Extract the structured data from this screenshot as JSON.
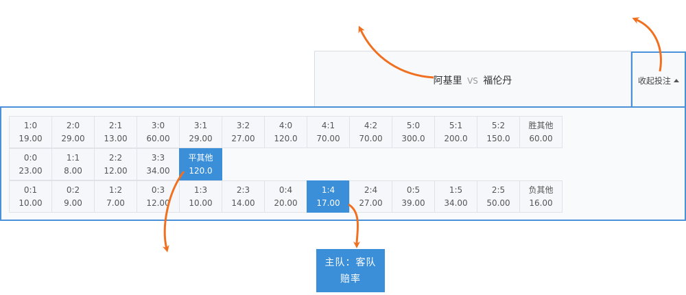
{
  "match": {
    "home": "阿基里",
    "vs": "VS",
    "away": "福伦丹"
  },
  "toggle": {
    "label": "收起投注"
  },
  "rows": [
    [
      {
        "score": "1:0",
        "odds": "19.00"
      },
      {
        "score": "2:0",
        "odds": "29.00"
      },
      {
        "score": "2:1",
        "odds": "13.00"
      },
      {
        "score": "3:0",
        "odds": "60.00"
      },
      {
        "score": "3:1",
        "odds": "29.00"
      },
      {
        "score": "3:2",
        "odds": "27.00"
      },
      {
        "score": "4:0",
        "odds": "120.0"
      },
      {
        "score": "4:1",
        "odds": "70.00"
      },
      {
        "score": "4:2",
        "odds": "70.00"
      },
      {
        "score": "5:0",
        "odds": "300.0"
      },
      {
        "score": "5:1",
        "odds": "200.0"
      },
      {
        "score": "5:2",
        "odds": "150.0"
      },
      {
        "score": "胜其他",
        "odds": "60.00"
      }
    ],
    [
      {
        "score": "0:0",
        "odds": "23.00"
      },
      {
        "score": "1:1",
        "odds": "8.00"
      },
      {
        "score": "2:2",
        "odds": "12.00"
      },
      {
        "score": "3:3",
        "odds": "34.00"
      },
      {
        "score": "平其他",
        "odds": "120.0",
        "selected": true
      }
    ],
    [
      {
        "score": "0:1",
        "odds": "10.00"
      },
      {
        "score": "0:2",
        "odds": "9.00"
      },
      {
        "score": "1:2",
        "odds": "7.00"
      },
      {
        "score": "0:3",
        "odds": "12.00"
      },
      {
        "score": "1:3",
        "odds": "10.00"
      },
      {
        "score": "2:3",
        "odds": "14.00"
      },
      {
        "score": "0:4",
        "odds": "20.00"
      },
      {
        "score": "1:4",
        "odds": "17.00",
        "selected": true
      },
      {
        "score": "2:4",
        "odds": "27.00"
      },
      {
        "score": "0:5",
        "odds": "39.00"
      },
      {
        "score": "1:5",
        "odds": "34.00"
      },
      {
        "score": "2:5",
        "odds": "50.00"
      },
      {
        "score": "负其他",
        "odds": "16.00"
      }
    ]
  ],
  "annotation": {
    "line1": "主队：客队",
    "line2": "赔率"
  },
  "colors": {
    "accent": "#3b8fd9",
    "arrow": "#f07020"
  }
}
